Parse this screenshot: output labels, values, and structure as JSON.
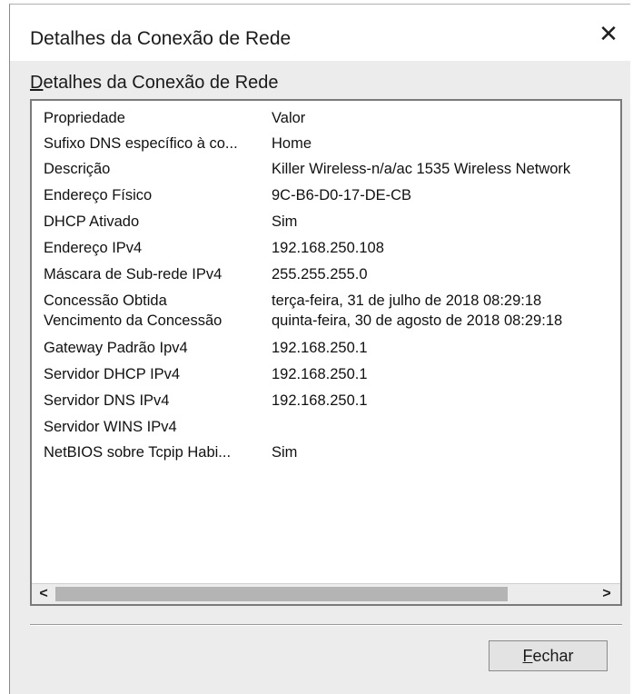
{
  "window": {
    "title": "Detalhes da Conexão de Rede",
    "close_glyph": "✕"
  },
  "group": {
    "label_accel": "D",
    "label_rest": "etalhes da Conexão de Rede"
  },
  "table": {
    "columns": [
      "Propriedade",
      "Valor"
    ],
    "rows": [
      {
        "property": "Sufixo DNS específico à co...",
        "value": "Home"
      },
      {
        "property": "Descrição",
        "value": "Killer Wireless-n/a/ac 1535 Wireless Network"
      },
      {
        "property": "Endereço Físico",
        "value": "9C-B6-D0-17-DE-CB"
      },
      {
        "property": "DHCP Ativado",
        "value": "Sim"
      },
      {
        "property": "Endereço IPv4",
        "value": "192.168.250.108"
      },
      {
        "property": "Máscara de Sub-rede IPv4",
        "value": "255.255.255.0"
      },
      {
        "property": "Concessão Obtida",
        "value": "terça-feira, 31 de julho de 2018 08:29:18"
      },
      {
        "property": "Vencimento da Concessão",
        "value": "quinta-feira, 30 de agosto de 2018 08:29:18"
      },
      {
        "property": "Gateway Padrão Ipv4",
        "value": "192.168.250.1"
      },
      {
        "property": "Servidor DHCP IPv4",
        "value": "192.168.250.1"
      },
      {
        "property": "Servidor DNS IPv4",
        "value": "192.168.250.1"
      },
      {
        "property": "Servidor WINS IPv4",
        "value": ""
      },
      {
        "property": "NetBIOS sobre Tcpip Habi...",
        "value": "Sim"
      }
    ]
  },
  "scrollbar": {
    "left_glyph": "<",
    "right_glyph": ">"
  },
  "buttons": {
    "close_accel": "F",
    "close_rest": "echar"
  }
}
